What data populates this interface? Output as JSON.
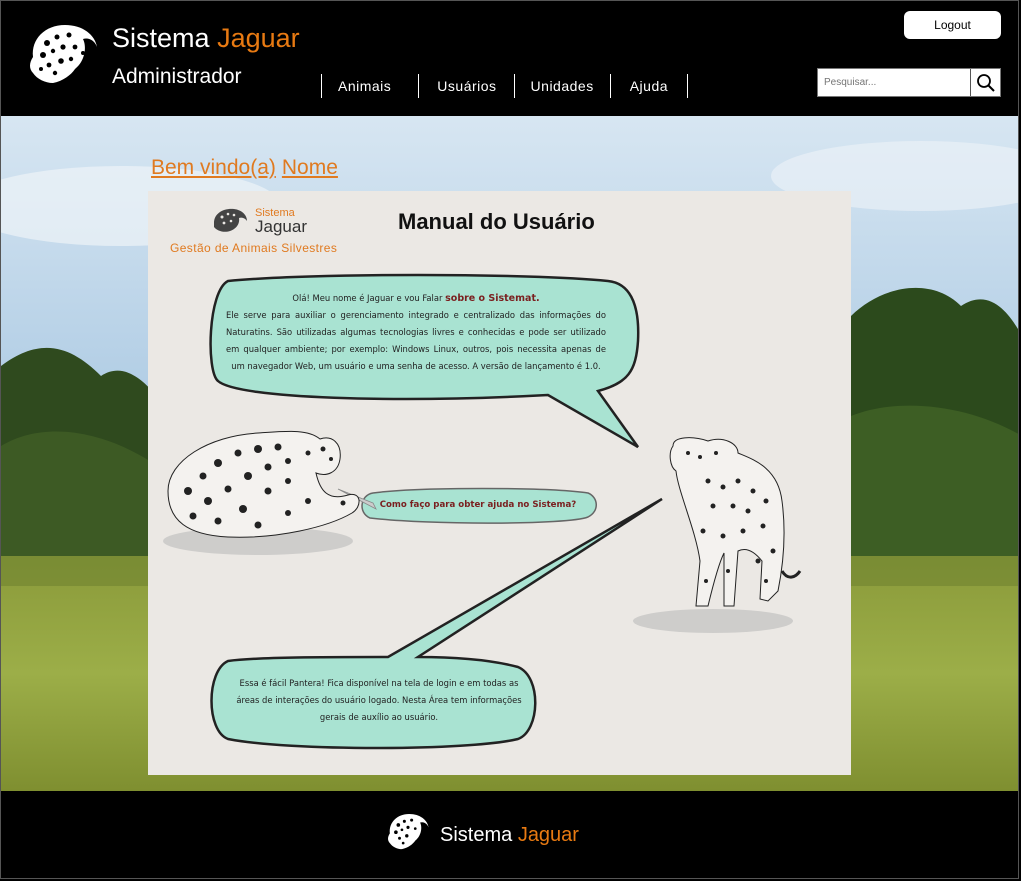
{
  "header": {
    "brand_first": "Sistema",
    "brand_second": "Jaguar",
    "role": "Administrador",
    "logout_label": "Logout",
    "nav": [
      {
        "label": "Animais"
      },
      {
        "label": "Usuários"
      },
      {
        "label": "Unidades"
      },
      {
        "label": "Ajuda"
      }
    ],
    "search_placeholder": "Pesquisar...",
    "search_icon": "magnifier-icon"
  },
  "main": {
    "welcome_prefix": "Bem vindo(a)",
    "welcome_name": "Nome",
    "manual": {
      "title": "Manual do Usuário",
      "logo_sistema": "Sistema",
      "logo_jaguar": "Jaguar",
      "subtitle": "Gestão de Animais Silvestres",
      "bubble1_intro": "Olá! Meu nome é Jaguar e vou Falar",
      "bubble1_highlight": "sobre o Sistemat.",
      "bubble1_body": "Ele serve para auxiliar o gerenciamento integrado e centralizado das informações do Naturatins. São utilizadas algumas tecnologias livres e conhecidas e pode ser utilizado em qualquer ambiente; por exemplo: Windows Linux, outros, pois necessita apenas de um navegador Web, um usuário e uma senha de acesso. A versão de lançamento é 1.0.",
      "bubble2": "Como faço para obter ajuda no Sistema?",
      "bubble3": "Essa é fácil Pantera!  Fica disponível na tela de login e em todas as áreas de interações do usuário logado. Nesta Área tem informações gerais de auxílio ao usuário."
    }
  },
  "footer": {
    "brand_first": "Sistema",
    "brand_second": "Jaguar"
  },
  "colors": {
    "accent": "#e87a12",
    "bubble_fill": "#a9e3d2",
    "header_bg": "#000000"
  }
}
